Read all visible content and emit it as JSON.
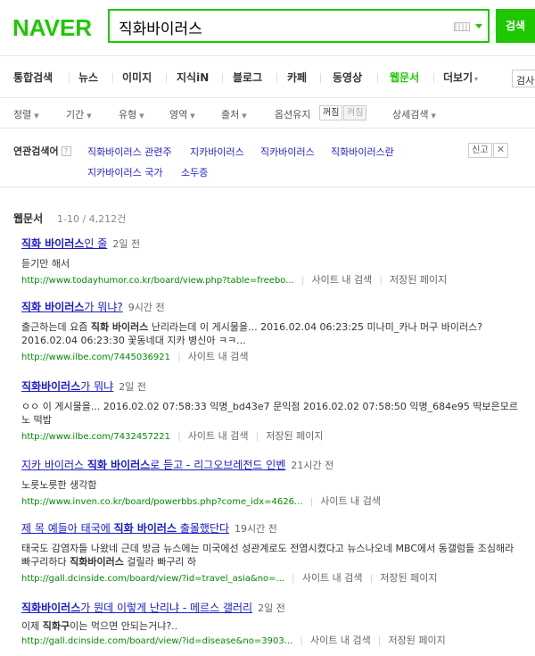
{
  "header": {
    "logo": "NAVER",
    "query": "직화바이러스",
    "search_button": "검색"
  },
  "tabs": [
    {
      "label": "통합검색"
    },
    {
      "label": "뉴스"
    },
    {
      "label": "이미지"
    },
    {
      "label": "지식iN"
    },
    {
      "label": "블로그"
    },
    {
      "label": "카페"
    },
    {
      "label": "동영상"
    },
    {
      "label": "웹문서",
      "active": true
    },
    {
      "label": "더보기"
    }
  ],
  "tab_search_label": "검사",
  "options": {
    "sort": "정렬",
    "period": "기간",
    "type": "유형",
    "area": "영역",
    "source": "출처",
    "option_keep": "옵션유지",
    "keep_on": "꺼짐",
    "keep_off": "켜짐",
    "detail": "상세검색"
  },
  "related": {
    "title": "연관검색어",
    "help": "?",
    "items": [
      "직화바이러스 관련주",
      "지카바이러스",
      "직카바이러스",
      "직화바이러스란",
      "지카바이러스 국가",
      "소두증"
    ],
    "report": "신고",
    "close": "✕"
  },
  "section": {
    "title": "웹문서",
    "count": "1-10 / 4,212건"
  },
  "results": [
    {
      "title_parts": [
        {
          "t": "직화 바이러스",
          "b": true
        },
        {
          "t": "인 줄",
          "b": false
        }
      ],
      "time": "2일 전",
      "desc": [
        {
          "t": "듣기만 해서",
          "b": false
        }
      ],
      "url": "http://www.todayhumor.co.kr/board/view.php?table=freebo...",
      "links": [
        "사이트 내 검색",
        "저장된 페이지"
      ]
    },
    {
      "title_parts": [
        {
          "t": "직화 바이러스",
          "b": true
        },
        {
          "t": "가 뭐냐?",
          "b": false
        }
      ],
      "time": "9시간 전",
      "desc": [
        {
          "t": "출근하는데 요즘 ",
          "b": false
        },
        {
          "t": "직화 바이러스",
          "b": true
        },
        {
          "t": " 난리라는데 이 게시물을... 2016.02.04 06:23:25 미나미_카나 머구 바이러스? 2016.02.04 06:23:30 꽃동네대 지카 병신아 ㅋㅋ...",
          "b": false
        }
      ],
      "url": "http://www.ilbe.com/7445036921",
      "links": [
        "사이트 내 검색"
      ]
    },
    {
      "title_parts": [
        {
          "t": "직화바이러스",
          "b": true
        },
        {
          "t": "가 뭐냐",
          "b": false
        }
      ],
      "time": "2일 전",
      "desc": [
        {
          "t": "ㅇㅇ 이 게시물을... 2016.02.02 07:58:33 익명_bd43e7 문익점 2016.02.02 07:58:50 익명_684e95 딱보은모르노 떡밥",
          "b": false
        }
      ],
      "url": "http://www.ilbe.com/7432457221",
      "links": [
        "사이트 내 검색",
        "저장된 페이지"
      ]
    },
    {
      "title_parts": [
        {
          "t": "지카 바이러스 ",
          "b": false
        },
        {
          "t": "직화 바이러스",
          "b": true
        },
        {
          "t": "로 듣고 - 리그오브레전드 인벤",
          "b": false
        }
      ],
      "time": "21시간 전",
      "desc": [
        {
          "t": "노릇노릇한 생각함",
          "b": false
        }
      ],
      "url": "http://www.inven.co.kr/board/powerbbs.php?come_idx=4626...",
      "links": [
        "사이트 내 검색"
      ]
    },
    {
      "title_parts": [
        {
          "t": "제 목 예들아 태국에 ",
          "b": false
        },
        {
          "t": "직화 바이러스",
          "b": true
        },
        {
          "t": " 출몰했단다",
          "b": false
        }
      ],
      "time": "19시간 전",
      "desc": [
        {
          "t": "태국도 감염자들 나왔네 근데 방금 뉴스에는 미국에선 성관계로도 전염시켰다고 뉴스나오네 MBC에서 동갤럼들 조심해라 빠구리하다 ",
          "b": false
        },
        {
          "t": "직화바이러스",
          "b": true
        },
        {
          "t": " 걸릴라 빠구리 하",
          "b": false
        }
      ],
      "url": "http://gall.dcinside.com/board/view/?id=travel_asia&no=...",
      "links": [
        "사이트 내 검색",
        "저장된 페이지"
      ]
    },
    {
      "title_parts": [
        {
          "t": "직화바이러스",
          "b": true
        },
        {
          "t": "가 뭔데 이렇게 난리냐 - 메르스 갤러리",
          "b": false
        }
      ],
      "time": "2일 전",
      "desc": [
        {
          "t": "이제 ",
          "b": false
        },
        {
          "t": "직화구",
          "b": true
        },
        {
          "t": "이는 먹으면 안되는거냐?..",
          "b": false
        }
      ],
      "url": "http://gall.dcinside.com/board/view/?id=disease&no=3903...",
      "links": [
        "사이트 내 검색",
        "저장된 페이지"
      ]
    }
  ]
}
